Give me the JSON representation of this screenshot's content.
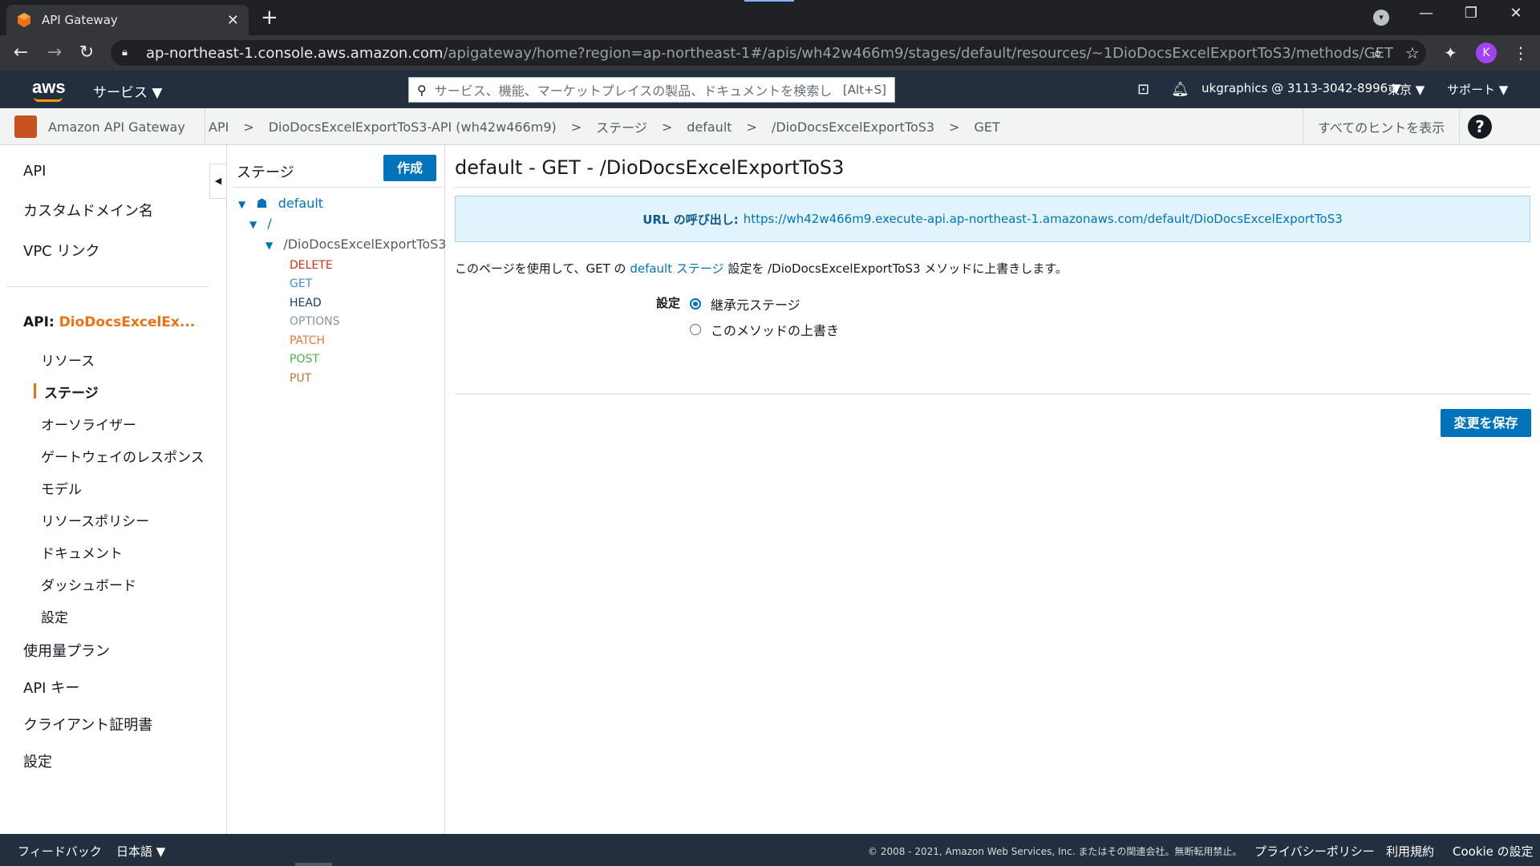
{
  "browser": {
    "tab_title": "API Gateway",
    "tab_close": "✕",
    "new_tab": "+",
    "url_host": "ap-northeast-1.console.aws.amazon.com",
    "url_path": "/apigateway/home?region=ap-northeast-1#/apis/wh42w466m9/stages/default/resources/~1DioDocsExcelExportToS3/methods/GET",
    "avatar_letter": "K"
  },
  "awsnav": {
    "logo": "aws",
    "services": "サービス ▼",
    "search_placeholder": "サービス、機能、マーケットプレイスの製品、ドキュメントを検索し",
    "search_shortcut": "[Alt+S]",
    "account": "ukgraphics @ 3113-3042-8996 ▼",
    "region": "東京 ▼",
    "support": "サポート ▼"
  },
  "breadcrumb": {
    "service": "Amazon API Gateway",
    "items": [
      "API",
      "DioDocsExcelExportToS3-API (wh42w466m9)",
      "ステージ",
      "default",
      "/DioDocsExcelExportToS3",
      "GET"
    ],
    "separator": ">",
    "hints": "すべてのヒントを表示",
    "help": "?"
  },
  "leftnav": {
    "top": [
      "API",
      "カスタムドメイン名",
      "VPC リンク"
    ],
    "api_prefix": "API: ",
    "api_name": "DioDocsExcelEx...",
    "sub": [
      "リソース",
      "ステージ",
      "オーソライザー",
      "ゲートウェイのレスポンス",
      "モデル",
      "リソースポリシー",
      "ドキュメント",
      "ダッシュボード",
      "設定"
    ],
    "bottom": [
      "使用量プラン",
      "API キー",
      "クライアント証明書",
      "設定"
    ]
  },
  "tree": {
    "title": "ステージ",
    "create": "作成",
    "stage": "default",
    "root": "/",
    "resource": "/DioDocsExcelExportToS3",
    "methods": [
      {
        "name": "DELETE",
        "color": "#d13212"
      },
      {
        "name": "GET",
        "color": "#3b8fd9"
      },
      {
        "name": "HEAD",
        "color": "#1a3a6b"
      },
      {
        "name": "OPTIONS",
        "color": "#879596"
      },
      {
        "name": "PATCH",
        "color": "#e07b39"
      },
      {
        "name": "POST",
        "color": "#4cb04c"
      },
      {
        "name": "PUT",
        "color": "#c0783a"
      }
    ]
  },
  "main": {
    "title": "default - GET - /DioDocsExcelExportToS3",
    "invoke_label": "URL の呼び出し:",
    "invoke_url": "https://wh42w466m9.execute-api.ap-northeast-1.amazonaws.com/default/DioDocsExcelExportToS3",
    "desc_pre": "このページを使用して、GET の ",
    "desc_link": "default ステージ",
    "desc_post": " 設定を /DioDocsExcelExportToS3 メソッドに上書きします。",
    "setting_label": "設定",
    "radio_inherit": "継承元ステージ",
    "radio_override": "このメソッドの上書き",
    "save": "変更を保存"
  },
  "footer": {
    "feedback": "フィードバック",
    "language": "日本語 ▼",
    "copyright": "© 2008 - 2021, Amazon Web Services, Inc. またはその関連会社。無断転用禁止。",
    "privacy": "プライバシーポリシー",
    "terms": "利用規約",
    "cookie": "Cookie の設定"
  },
  "colors": {
    "aws_dark": "#232f3e",
    "accent_orange": "#ec7211",
    "link_blue": "#0073bb"
  }
}
